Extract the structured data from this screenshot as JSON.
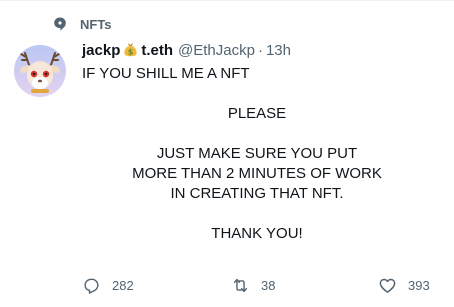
{
  "context": {
    "label": "NFTs",
    "icon": "topic-bubble-icon"
  },
  "author": {
    "name_part1": "jackp",
    "name_emoji": "money-bag-emoji",
    "name_part2": "t.eth",
    "handle": "@EthJackp",
    "separator": "·",
    "time": "13h"
  },
  "tweet": {
    "line1": "IF YOU SHILL ME A NFT",
    "line2": "PLEASE",
    "line3": "JUST MAKE SURE YOU PUT",
    "line4": "MORE THAN 2 MINUTES OF WORK",
    "line5": "IN CREATING THAT NFT.",
    "line6": "THANK YOU!"
  },
  "actions": {
    "replies": "282",
    "retweets": "38",
    "likes": "393"
  },
  "colors": {
    "text_primary": "#0f1419",
    "text_secondary": "#536471",
    "avatar_bg": "#c9d4f5"
  }
}
